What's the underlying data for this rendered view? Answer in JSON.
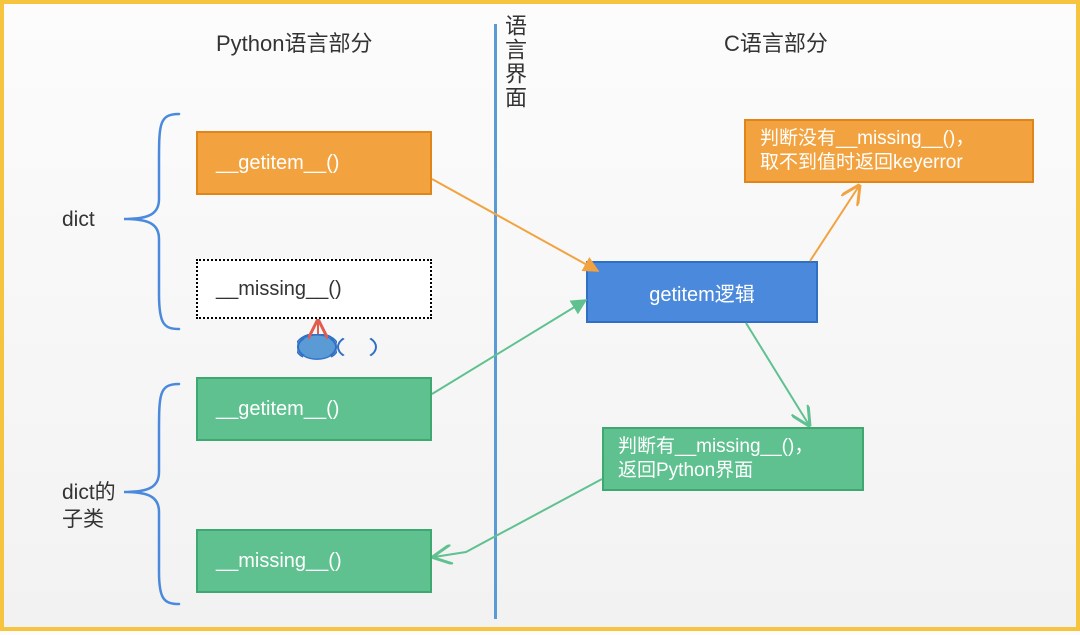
{
  "headings": {
    "python_side": "Python语言部分",
    "c_side": "C语言部分",
    "divider_label": "语言界面"
  },
  "side_labels": {
    "dict": "dict",
    "dict_subclass_line1": "dict的",
    "dict_subclass_line2": "子类"
  },
  "boxes": {
    "getitem_orange": "__getitem__()",
    "missing_dotted": "__missing__()",
    "getitem_green": "__getitem__()",
    "missing_green": "__missing__()",
    "getitem_logic": "getitem逻辑",
    "orange_result_line1": "判断没有__missing__()，",
    "orange_result_line2": "取不到值时返回keyerror",
    "green_result_line1": "判断有__missing__()，",
    "green_result_line2": "返回Python界面"
  },
  "colors": {
    "orange": "#f2a340",
    "green": "#5fc190",
    "blue": "#4a89dc",
    "frame": "#f7c43f"
  }
}
